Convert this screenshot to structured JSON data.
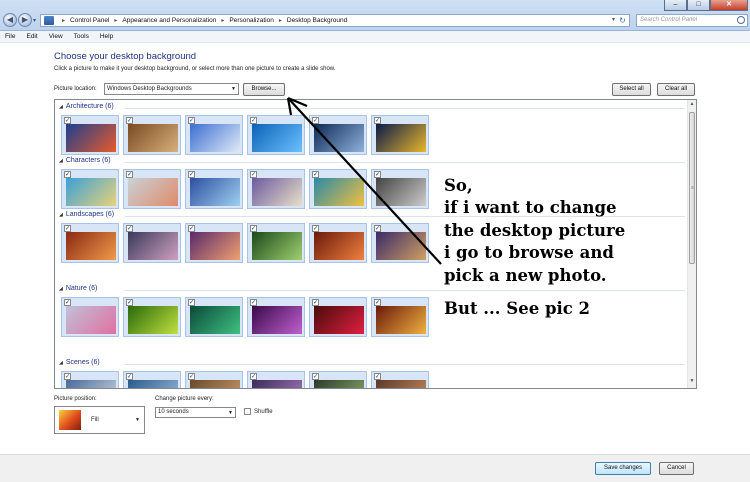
{
  "window": {
    "minimize_glyph": "–",
    "maximize_glyph": "□",
    "close_glyph": "✕"
  },
  "address": {
    "breadcrumbs": [
      "Control Panel",
      "Appearance and Personalization",
      "Personalization",
      "Desktop Background"
    ],
    "separator": "▸",
    "search_placeholder": "Search Control Panel"
  },
  "menu": [
    "File",
    "Edit",
    "View",
    "Tools",
    "Help"
  ],
  "page": {
    "title": "Choose your desktop background",
    "subtitle": "Click a picture to make it your desktop background, or select more than one picture to create a slide show.",
    "location_label": "Picture location:",
    "location_value": "Windows Desktop Backgrounds",
    "browse_label": "Browse...",
    "select_all_label": "Select all",
    "clear_all_label": "Clear all"
  },
  "gallery": {
    "categories": [
      {
        "name": "Architecture (6)",
        "count": 6,
        "pictures": [
          "architecture-1",
          "architecture-2",
          "architecture-3",
          "architecture-4",
          "architecture-5",
          "architecture-6"
        ]
      },
      {
        "name": "Characters (6)",
        "count": 6,
        "pictures": [
          "characters-1",
          "characters-2",
          "characters-3",
          "characters-4",
          "characters-5",
          "characters-6"
        ]
      },
      {
        "name": "Landscapes (6)",
        "count": 6,
        "pictures": [
          "landscapes-1",
          "landscapes-2",
          "landscapes-3",
          "landscapes-4",
          "landscapes-5",
          "landscapes-6"
        ]
      },
      {
        "name": "Nature (6)",
        "count": 6,
        "pictures": [
          "nature-1",
          "nature-2",
          "nature-3",
          "nature-4",
          "nature-5",
          "nature-6"
        ]
      },
      {
        "name": "Scenes (6)",
        "count": 6,
        "pictures": [
          "scenes-1",
          "scenes-2",
          "scenes-3",
          "scenes-4",
          "scenes-5",
          "scenes-6"
        ]
      }
    ],
    "all_selected": true
  },
  "annotation": {
    "lines": [
      "So,",
      "if i want to change",
      "the desktop picture",
      "i go to browse and",
      "pick a new photo."
    ],
    "footer": "But ... See pic 2"
  },
  "bottom": {
    "position_label": "Picture position:",
    "position_value": "Fill",
    "change_label": "Change picture every:",
    "change_value": "10 seconds",
    "shuffle_label": "Shuffle",
    "shuffle_checked": false,
    "save_label": "Save changes",
    "cancel_label": "Cancel"
  }
}
